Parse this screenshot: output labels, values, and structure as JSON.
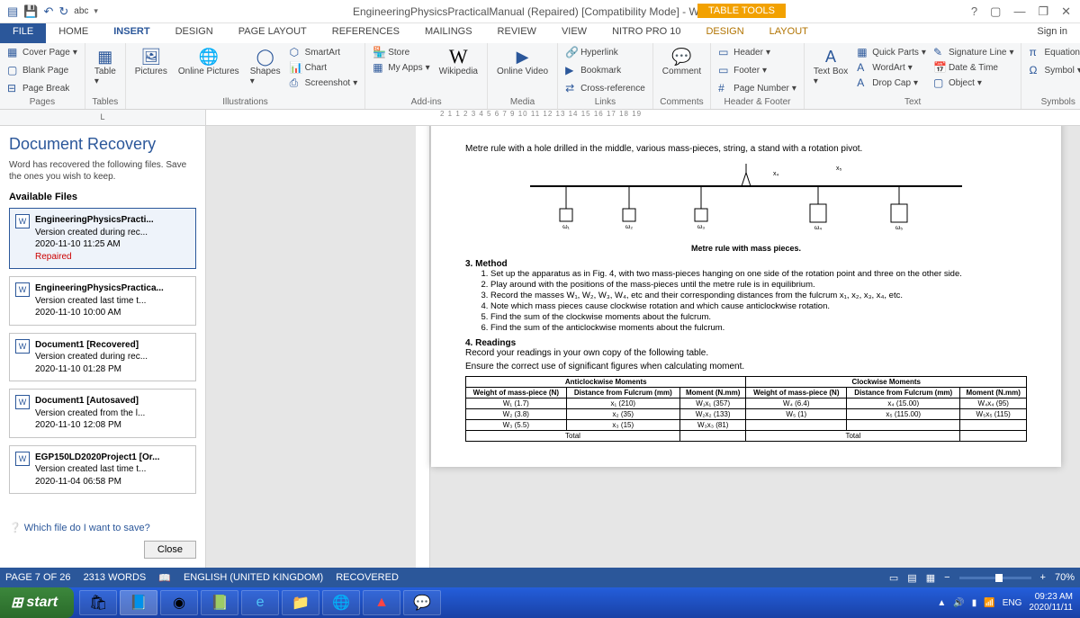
{
  "titlebar": {
    "title": "EngineeringPhysicsPracticalManual (Repaired) [Compatibility Mode] - Word",
    "table_tools": "TABLE TOOLS",
    "signin": "Sign in",
    "qat_abc": "abc"
  },
  "tabs": {
    "file": "FILE",
    "home": "HOME",
    "insert": "INSERT",
    "design": "DESIGN",
    "pagelayout": "PAGE LAYOUT",
    "references": "REFERENCES",
    "mailings": "MAILINGS",
    "review": "REVIEW",
    "view": "VIEW",
    "nitro": "NITRO PRO 10",
    "ctx_design": "DESIGN",
    "ctx_layout": "LAYOUT"
  },
  "ribbon": {
    "pages": {
      "label": "Pages",
      "cover": "Cover Page",
      "blank": "Blank Page",
      "break": "Page Break"
    },
    "tables": {
      "label": "Tables",
      "table": "Table"
    },
    "illus": {
      "label": "Illustrations",
      "pictures": "Pictures",
      "online": "Online Pictures",
      "shapes": "Shapes",
      "smartart": "SmartArt",
      "chart": "Chart",
      "screenshot": "Screenshot"
    },
    "addins": {
      "label": "Add-ins",
      "store": "Store",
      "myapps": "My Apps",
      "wikipedia": "Wikipedia"
    },
    "media": {
      "label": "Media",
      "video": "Online Video"
    },
    "links": {
      "label": "Links",
      "hyperlink": "Hyperlink",
      "bookmark": "Bookmark",
      "crossref": "Cross-reference"
    },
    "comments": {
      "label": "Comments",
      "comment": "Comment"
    },
    "headerfooter": {
      "label": "Header & Footer",
      "header": "Header",
      "footer": "Footer",
      "pagenum": "Page Number"
    },
    "text": {
      "label": "Text",
      "textbox": "Text Box",
      "quickparts": "Quick Parts",
      "wordart": "WordArt",
      "dropcap": "Drop Cap",
      "sigline": "Signature Line",
      "datetime": "Date & Time",
      "object": "Object"
    },
    "symbols": {
      "label": "Symbols",
      "equation": "Equation",
      "symbol": "Symbol"
    }
  },
  "recovery": {
    "title": "Document Recovery",
    "desc": "Word has recovered the following files. Save the ones you wish to keep.",
    "available": "Available Files",
    "files": [
      {
        "name": "EngineeringPhysicsPracti...",
        "sub": "Version created during rec...",
        "date": "2020-11-10 11:25 AM",
        "status": "Repaired"
      },
      {
        "name": "EngineeringPhysicsPractica...",
        "sub": "Version created last time t...",
        "date": "2020-11-10 10:00 AM"
      },
      {
        "name": "Document1 [Recovered]",
        "sub": "Version created during rec...",
        "date": "2020-11-10 01:28 PM"
      },
      {
        "name": "Document1 [Autosaved]",
        "sub": "Version created from the l...",
        "date": "2020-11-10 12:08 PM"
      },
      {
        "name": "EGP150LD2020Project1 [Or...",
        "sub": "Version created last time t...",
        "date": "2020-11-04 06:58 PM"
      }
    ],
    "whichlink": "Which file do I want to save?",
    "close": "Close"
  },
  "doc": {
    "intro": "Metre rule with a hole drilled in the middle, various mass-pieces, string, a stand with a rotation pivot.",
    "caption": "Metre rule with mass pieces.",
    "method_h": "3. Method",
    "steps": [
      "Set up the apparatus as in Fig. 4, with two mass-pieces hanging on one side of the rotation point and three on the other side.",
      "Play around with the positions of the mass-pieces until the metre rule is in equilibrium.",
      "Record the masses W₁, W₂, W₃, W₄, etc and their corresponding distances from the fulcrum x₁, x₂, x₃, x₄, etc.",
      "Note which mass pieces cause clockwise rotation and which cause anticlockwise rotation.",
      "Find the sum of the clockwise moments about the fulcrum.",
      "Find the sum of the anticlockwise moments about the fulcrum."
    ],
    "readings_h": "4. Readings",
    "readings_p1": "Record your readings in your own copy of the following table.",
    "readings_p2": "Ensure the correct use of significant figures when calculating moment.",
    "table": {
      "anticw": "Anticlockwise Moments",
      "cw": "Clockwise Moments",
      "h1": "Weight of mass-piece (N)",
      "h2": "Distance from Fulcrum (mm)",
      "h3": "Moment (N.mm)",
      "rows_acw": [
        [
          "W₁ (1.7)",
          "x₁ (210)",
          "W₁x₁ (357)"
        ],
        [
          "W₂ (3.8)",
          "x₂ (35)",
          "W₂x₂ (133)"
        ],
        [
          "W₃ (5.5)",
          "x₃ (15)",
          "W₃x₃ (81)"
        ]
      ],
      "rows_cw": [
        [
          "W₄ (6.4)",
          "x₄ (15.00)",
          "W₄x₄ (95)"
        ],
        [
          "W₅ (1)",
          "x₅ (115.00)",
          "W₅x₅ (115)"
        ]
      ],
      "total": "Total"
    }
  },
  "statusbar": {
    "page": "PAGE 7 OF 26",
    "words": "2313 WORDS",
    "lang": "ENGLISH (UNITED KINGDOM)",
    "recovered": "RECOVERED",
    "zoom": "70%"
  },
  "taskbar": {
    "start": "start",
    "time": "09:23 AM",
    "date": "2020/11/11",
    "lang": "ENG"
  },
  "ruler_text": "2   1       1   2   3   4   5   6   7       9   10   11   12   13   14   15   16   17   18   19"
}
